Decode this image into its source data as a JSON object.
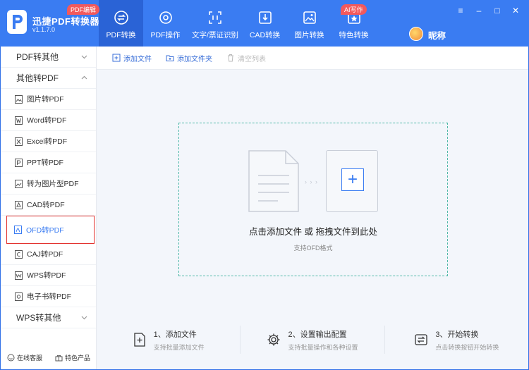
{
  "app": {
    "name": "迅捷PDF转换器",
    "version": "v1.1.7.0"
  },
  "nav": [
    {
      "label": "PDF转换",
      "icon": "swap-icon",
      "active": true
    },
    {
      "label": "PDF操作",
      "icon": "gear-doc-icon"
    },
    {
      "label": "文字/票证识别",
      "icon": "scan-icon"
    },
    {
      "label": "CAD转换",
      "icon": "download-box-icon"
    },
    {
      "label": "图片转换",
      "icon": "image-icon"
    },
    {
      "label": "特色转换",
      "icon": "star-box-icon"
    }
  ],
  "badges": {
    "pdf_edit": "PDF编辑",
    "ai_write": "AI写作"
  },
  "user": {
    "nickname": "昵称"
  },
  "window_controls": {
    "menu": "≡",
    "minimize": "–",
    "maximize": "□",
    "close": "✕"
  },
  "sidebar": {
    "group_pdf_to_other": "PDF转其他",
    "group_other_to_pdf": "其他转PDF",
    "items": [
      "图片转PDF",
      "Word转PDF",
      "Excel转PDF",
      "PPT转PDF",
      "转为图片型PDF",
      "CAD转PDF",
      "OFD转PDF",
      "CAJ转PDF",
      "WPS转PDF",
      "电子书转PDF"
    ],
    "active_index": 6,
    "group_wps_to_other": "WPS转其他",
    "footer_service": "在线客服",
    "footer_features": "特色产品"
  },
  "toolbar": {
    "add_file": "添加文件",
    "add_folder": "添加文件夹",
    "clear_list": "清空列表"
  },
  "dropzone": {
    "main_text": "点击添加文件 或 拖拽文件到此处",
    "sub_text": "支持OFD格式",
    "arrows": "› › ›"
  },
  "steps": [
    {
      "title": "1、添加文件",
      "desc": "支持批量添加文件",
      "icon": "add-file-icon"
    },
    {
      "title": "2、设置输出配置",
      "desc": "支持批量操作和各种设置",
      "icon": "settings-icon"
    },
    {
      "title": "3、开始转换",
      "desc": "点击转换按钮开始转换",
      "icon": "convert-icon"
    }
  ],
  "colors": {
    "header": "#3a7cf2",
    "header_active": "#2a63d6",
    "accent": "#3a7cf2",
    "badge": "#f2595c",
    "highlight_border": "#e3332f",
    "dropzone_border": "#4fb8a8"
  }
}
